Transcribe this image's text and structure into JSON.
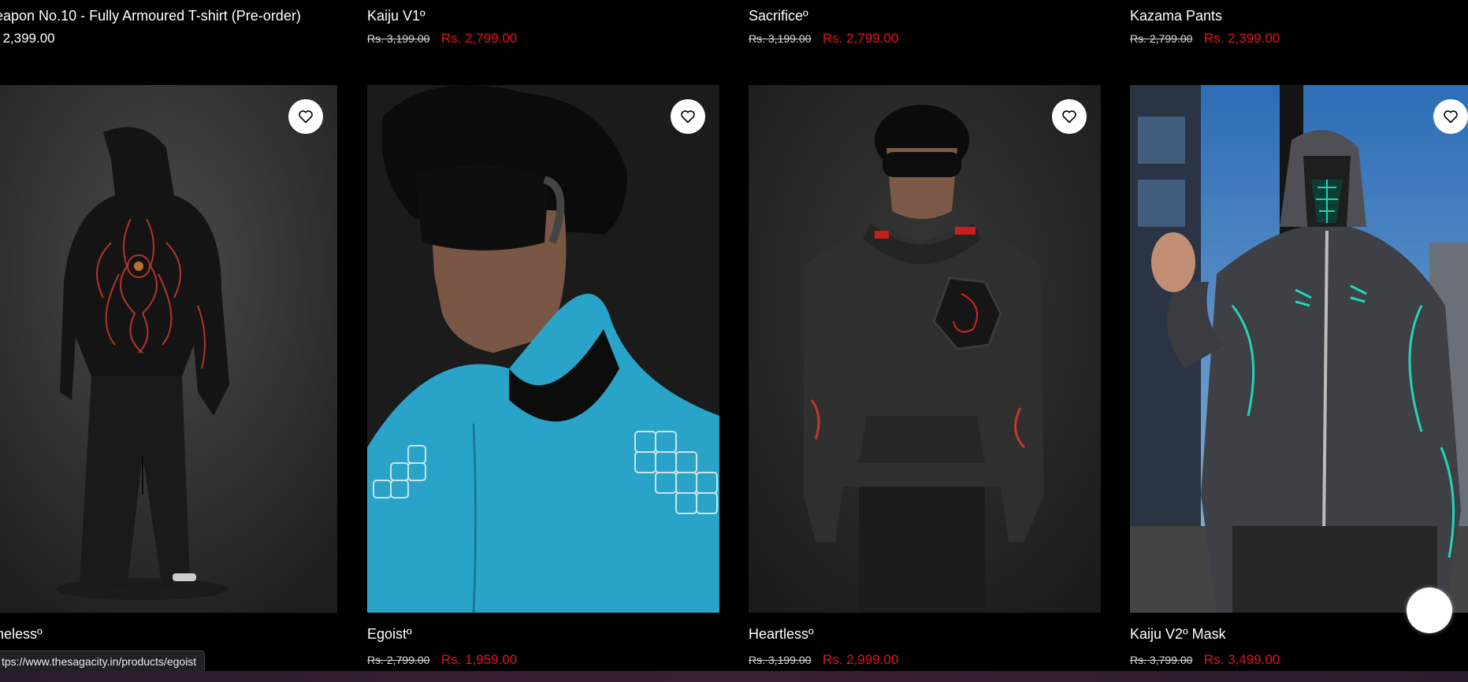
{
  "top_row": [
    {
      "title": "eapon No.10 - Fully Armoured T-shirt (Pre-order)",
      "old_price": "",
      "price": ". 2,399.00"
    },
    {
      "title": "Kaiju V1º",
      "old_price": "Rs. 3,199.00",
      "price": "Rs. 2,799.00"
    },
    {
      "title": "Sacrificeº",
      "old_price": "Rs. 3,199.00",
      "price": "Rs. 2,799.00"
    },
    {
      "title": "Kazama Pants",
      "old_price": "Rs. 2,799.00",
      "price": "Rs. 2,399.00"
    }
  ],
  "products": [
    {
      "title": "pinelessº",
      "old_price": "",
      "price": "",
      "image": "black-hoodie-back-red-embroidery"
    },
    {
      "title": "Egoistº",
      "old_price": "Rs. 2,799.00",
      "price": "Rs. 1,959.00",
      "image": "blue-hoodie-puzzle-sleeves"
    },
    {
      "title": "Heartlessº",
      "old_price": "Rs. 3,199.00",
      "price": "Rs. 2,999.00",
      "image": "dark-grey-hoodie-red-patch"
    },
    {
      "title": "Kaiju V2º Mask",
      "old_price": "Rs. 3,799.00",
      "price": "Rs. 3,499.00",
      "image": "acid-wash-zip-hoodie-teal-mask"
    }
  ],
  "status_bar": {
    "url": "tps://www.thesagacity.in/products/egoist"
  },
  "icons": {
    "wishlist": "heart-icon",
    "chat": "chat-bubble-icon"
  },
  "colors": {
    "sale_price": "#e3141d",
    "background": "#000000"
  }
}
